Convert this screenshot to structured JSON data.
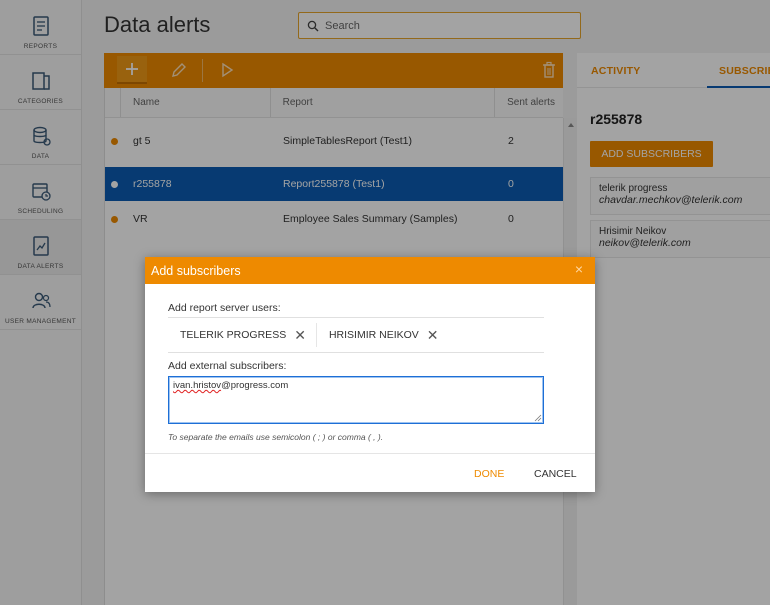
{
  "nav": {
    "items": [
      {
        "label": "REPORTS"
      },
      {
        "label": "CATEGORIES"
      },
      {
        "label": "DATA"
      },
      {
        "label": "SCHEDULING"
      },
      {
        "label": "DATA ALERTS"
      },
      {
        "label": "USER MANAGEMENT"
      }
    ]
  },
  "header": {
    "title": "Data alerts",
    "search_placeholder": "Search"
  },
  "table": {
    "columns": [
      "Name",
      "Report",
      "Sent alerts"
    ],
    "rows": [
      {
        "name": "gt 5",
        "report": "SimpleTablesReport (Test1)",
        "sent": "2"
      },
      {
        "name": "r255878",
        "report": "Report255878 (Test1)",
        "sent": "0"
      },
      {
        "name": "VR",
        "report": "Employee Sales Summary (Samples)",
        "sent": "0"
      }
    ]
  },
  "right_panel": {
    "tab_activity": "ACTIVITY",
    "tab_subscribers": "SUBSCRIBERS",
    "title": "r255878",
    "add_button": "ADD SUBSCRIBERS",
    "subscribers": [
      {
        "name": "telerik progress",
        "email": "chavdar.mechkov@telerik.com"
      },
      {
        "name": "Hrisimir Neikov",
        "email": "neikov@telerik.com"
      }
    ]
  },
  "dialog": {
    "title": "Add subscribers",
    "close": "×",
    "users_label": "Add report server users:",
    "chips": [
      "TELERIK PROGRESS",
      "HRISIMIR NEIKOV"
    ],
    "external_label": "Add external subscribers:",
    "external_value_underlined": "ivan.hristov",
    "external_value_rest": "@progress.com",
    "hint": "To separate the emails use semicolon ( ; ) or comma ( , ).",
    "done": "DONE",
    "cancel": "CANCEL"
  },
  "colors": {
    "accent": "#ee8a00",
    "selected_row": "#0b5cb2"
  }
}
